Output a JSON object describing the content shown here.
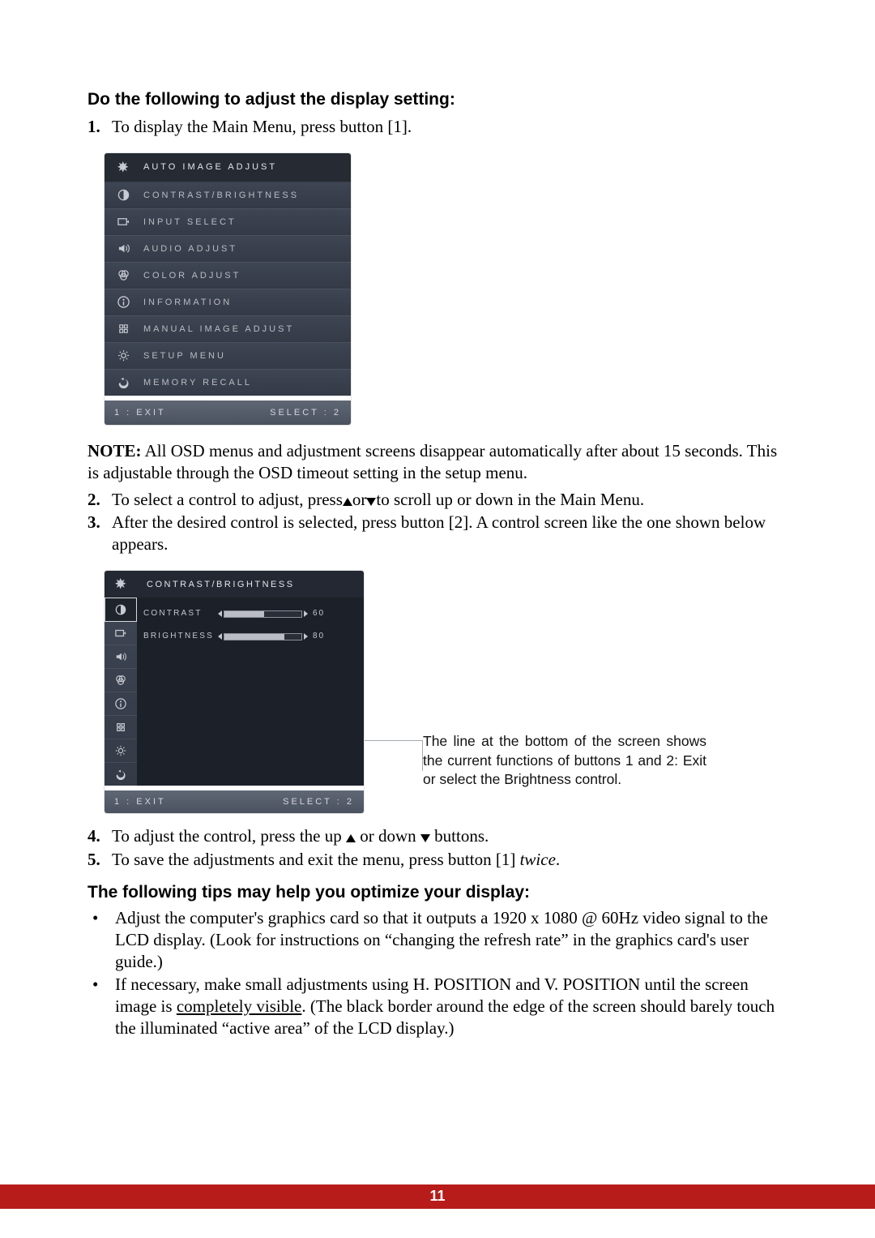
{
  "heading1": "Do the following to adjust the display setting:",
  "steps_a": {
    "s1_num": "1.",
    "s1_txt": "To display the Main Menu, press button [1]."
  },
  "menu1": {
    "items": [
      {
        "label": "AUTO IMAGE ADJUST",
        "icon": "auto-adjust-icon"
      },
      {
        "label": "CONTRAST/BRIGHTNESS",
        "icon": "contrast-icon"
      },
      {
        "label": "INPUT SELECT",
        "icon": "input-select-icon"
      },
      {
        "label": "AUDIO ADJUST",
        "icon": "audio-icon"
      },
      {
        "label": "COLOR ADJUST",
        "icon": "color-icon"
      },
      {
        "label": "INFORMATION",
        "icon": "info-icon"
      },
      {
        "label": "MANUAL IMAGE ADJUST",
        "icon": "manual-adjust-icon"
      },
      {
        "label": "SETUP MENU",
        "icon": "setup-icon"
      },
      {
        "label": "MEMORY RECALL",
        "icon": "recall-icon"
      }
    ],
    "footer_left": "1 : EXIT",
    "footer_right": "SELECT : 2"
  },
  "note_label": "NOTE:",
  "note_body": " All OSD menus and adjustment screens disappear automatically after about 15 seconds. This is adjustable through the OSD timeout setting in the setup menu.",
  "steps_b": {
    "s2_num": "2.",
    "s2_pre": "To select a control to adjust, press",
    "s2_mid": "or",
    "s2_post": "to scroll up or down in the Main Menu.",
    "s3_num": "3.",
    "s3_txt": "After the desired control is selected, press button [2]. A control screen like the one shown below appears."
  },
  "menu2": {
    "title": "CONTRAST/BRIGHTNESS",
    "row1_label": "CONTRAST",
    "row1_value": "60",
    "row1_fill_pct": 52,
    "row2_label": "BRIGHTNESS",
    "row2_value": "80",
    "row2_fill_pct": 78,
    "footer_left": "1 : EXIT",
    "footer_right": "SELECT : 2"
  },
  "annotation": "The line at the bottom of the screen shows the current functions of buttons 1 and 2: Exit or select the Brightness control.",
  "steps_c": {
    "s4_num": "4.",
    "s4_pre": "To adjust the control, press the up ",
    "s4_mid": " or down ",
    "s4_post": " buttons.",
    "s5_num": "5.",
    "s5_pre": "To save the adjustments and exit the menu, press button [1] ",
    "s5_em": "twice",
    "s5_post": "."
  },
  "heading2": "The following tips may help you optimize your display:",
  "tips": {
    "t1": "Adjust the computer's graphics card so that it outputs a 1920 x 1080 @ 60Hz video signal to the LCD display. (Look for instructions on “changing the refresh rate” in the graphics card's user guide.)",
    "t2_pre": "If necessary, make small adjustments using H. POSITION and V. POSITION until the screen image is ",
    "t2_underline": "completely visible",
    "t2_post": ". (The black border around the edge of the screen should barely touch the illuminated “active area” of the LCD display.)"
  },
  "page_number": "11"
}
